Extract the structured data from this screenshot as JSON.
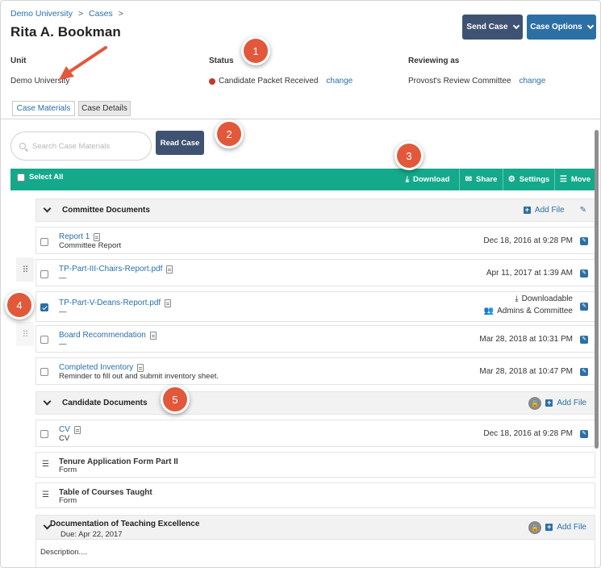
{
  "breadcrumb": {
    "items": [
      "Demo University",
      "Cases"
    ],
    "sep": ">"
  },
  "page_title": "Rita A. Bookman",
  "header_buttons": {
    "send_case": "Send Case",
    "case_options": "Case Options"
  },
  "meta": {
    "unit_label": "Unit",
    "unit_value": "Demo University",
    "status_label": "Status",
    "status_value": "Candidate Packet Received",
    "status_change": "change",
    "reviewing_label": "Reviewing as",
    "reviewing_value": "Provost's Review Committee",
    "reviewing_change": "change"
  },
  "tabs": [
    "Case Materials",
    "Case Details"
  ],
  "search": {
    "placeholder": "Search Case Materials"
  },
  "read_case": "Read Case",
  "toolbar": {
    "select_all": "Select All",
    "download": "Download",
    "share": "Share",
    "settings": "Settings",
    "move": "Move"
  },
  "sections": {
    "committee": {
      "title": "Committee Documents",
      "add_file": "Add File"
    },
    "candidate": {
      "title": "Candidate Documents",
      "add_file": "Add File"
    },
    "teaching": {
      "title": "Documentation of Teaching Excellence",
      "due": "Due: Apr 22, 2017",
      "add_file": "Add File",
      "description": "Description...."
    }
  },
  "committee_rows": [
    {
      "title": "Report 1",
      "sub": "Committee Report",
      "date": "Dec 18, 2016 at 9:28 PM"
    },
    {
      "title": "TP-Part-III-Chairs-Report.pdf",
      "sub": "—",
      "date": "Apr 11, 2017 at 1:39 AM"
    },
    {
      "title": "TP-Part-V-Deans-Report.pdf",
      "sub": "—",
      "downloadable": "Downloadable",
      "visibility": "Admins & Committee",
      "checked": true
    },
    {
      "title": "Board Recommendation",
      "sub": "—",
      "date": "Mar 28, 2018 at 10:31 PM"
    },
    {
      "title": "Completed Inventory",
      "sub": "Reminder to fill out and submit inventory sheet.",
      "date": "Mar 28, 2018 at 10:47 PM"
    }
  ],
  "candidate_rows": [
    {
      "title": "CV",
      "sub": "CV",
      "date": "Dec 18, 2016 at 9:28 PM"
    },
    {
      "title": "Tenure Application Form Part II",
      "sub": "Form"
    },
    {
      "title": "Table of Courses Taught",
      "sub": "Form"
    }
  ],
  "markers": [
    "1",
    "2",
    "3",
    "4",
    "5"
  ],
  "colors": {
    "accent_green": "#14a98b",
    "navy": "#3f5272",
    "blue": "#2c6fa5",
    "marker": "#e2583b",
    "status_dot": "#c0392b"
  }
}
